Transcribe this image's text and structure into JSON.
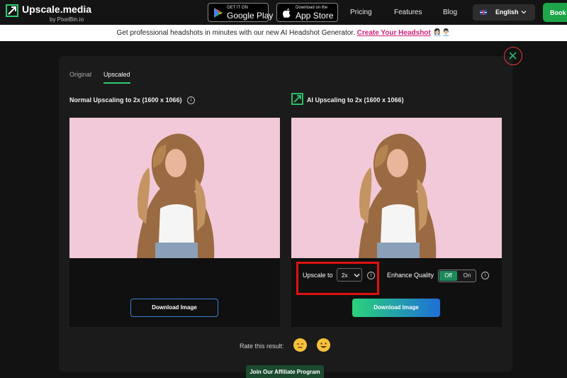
{
  "header": {
    "logo_name": "Upscale.media",
    "logo_by": "by PixelBin.io",
    "google_play": {
      "small": "GET IT ON",
      "big": "Google Play"
    },
    "app_store": {
      "small": "Download on the",
      "big": "App Store"
    },
    "nav": [
      "Pricing",
      "Features",
      "Blog"
    ],
    "language": "English",
    "book_label": "Book a"
  },
  "banner": {
    "text": "Get professional headshots in minutes with our new AI Headshot Generator.",
    "link": "Create Your Headshot",
    "emojis": "👩🏻‍💼👨🏻‍💼"
  },
  "tabs": {
    "original": "Original",
    "upscaled": "Upscaled",
    "active": "Upscaled"
  },
  "left_panel": {
    "title": "Normal Upscaling to 2x (1600 x 1066)",
    "download_label": "Download Image"
  },
  "right_panel": {
    "title": "AI Upscaling to 2x (1600 x 1066)",
    "upscale_label": "Upscale to",
    "upscale_value": "2x",
    "enhance_label": "Enhance Quality",
    "toggle_off": "Off",
    "toggle_on": "On",
    "toggle_state": "Off",
    "download_label": "Download Image"
  },
  "rating": {
    "label": "Rate this result:"
  },
  "affiliate_label": "Join Our Affiliate Program",
  "info_glyph": "i",
  "colors": {
    "accent_green": "#2ecc71",
    "highlight_red": "#e01010",
    "banner_link": "#d5217b",
    "photo_bg": "#f2c9d8"
  },
  "icons": [
    "upscale-logo-icon",
    "google-play-icon",
    "apple-icon",
    "uk-flag-icon",
    "chevron-down-icon",
    "close-icon",
    "info-icon",
    "ai-upscale-icon",
    "unamused-face-icon",
    "grinning-face-icon"
  ]
}
